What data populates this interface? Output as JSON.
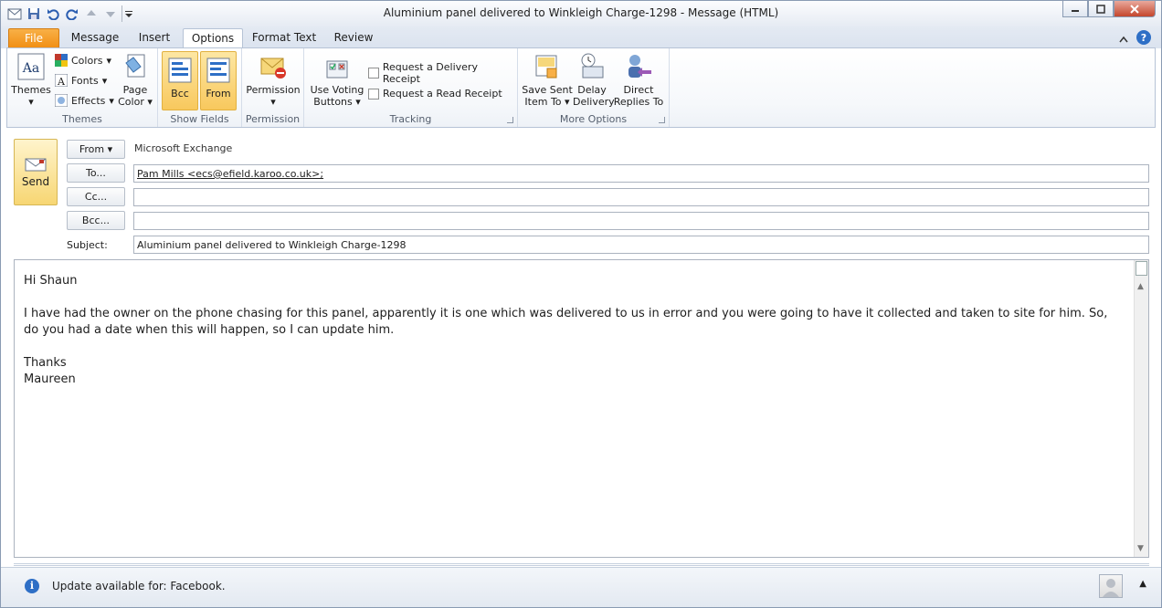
{
  "window": {
    "title": "Aluminium panel delivered to Winkleigh Charge-1298  -  Message (HTML)"
  },
  "tabs": [
    "File",
    "Message",
    "Insert",
    "Options",
    "Format Text",
    "Review"
  ],
  "active_tab": "Options",
  "ribbon": {
    "themes_group": {
      "label": "Themes",
      "themes": "Themes",
      "colors": "Colors",
      "fonts": "Fonts",
      "effects": "Effects",
      "page_color": "Page Color"
    },
    "show_fields_group": {
      "label": "Show Fields",
      "bcc": "Bcc",
      "from": "From"
    },
    "permission_group": {
      "label": "Permission",
      "permission": "Permission"
    },
    "tracking_group": {
      "label": "Tracking",
      "voting_line1": "Use Voting",
      "voting_line2": "Buttons",
      "delivery_receipt": "Request a Delivery Receipt",
      "read_receipt": "Request a Read Receipt"
    },
    "more_options_group": {
      "label": "More Options",
      "save_sent_line1": "Save Sent",
      "save_sent_line2": "Item To",
      "delay_line1": "Delay",
      "delay_line2": "Delivery",
      "direct_line1": "Direct",
      "direct_line2": "Replies To"
    }
  },
  "header": {
    "send_label": "Send",
    "from_btn": "From",
    "from_value": "Microsoft Exchange",
    "to_btn": "To...",
    "to_value": "Pam Mills <ecs@efield.karoo.co.uk>;",
    "cc_btn": "Cc...",
    "cc_value": "",
    "bcc_btn": "Bcc...",
    "bcc_value": "",
    "subject_label": "Subject:",
    "subject_value": "Aluminium panel delivered to Winkleigh Charge-1298"
  },
  "body": {
    "greeting": "Hi Shaun",
    "paragraph": "I have had the owner on the phone chasing for this panel, apparently it is one which was delivered to us in error and you were going to have it collected and taken to site for him.  So, do you had a date when this will happen, so I can update him.",
    "closing": "Thanks",
    "signature": "Maureen"
  },
  "status": {
    "text": "Update available for: Facebook."
  },
  "colors": {
    "file_tab": "#f18e12",
    "highlight": "#f8c85d",
    "info": "#2e6fc6"
  }
}
